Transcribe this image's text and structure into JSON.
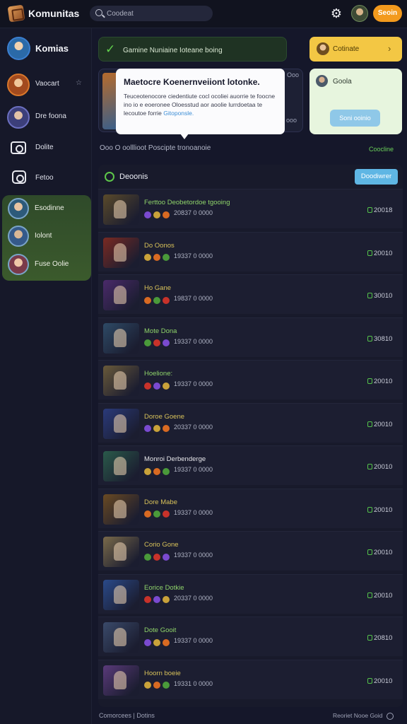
{
  "header": {
    "brand": "Komunitas",
    "search_placeholder": "Coodeat",
    "signin_label": "Seoin"
  },
  "sidebar": {
    "profile": {
      "label": "Komias"
    },
    "items": [
      {
        "label": "Vaocart",
        "icon": "avatar"
      },
      {
        "label": "Dre foona",
        "icon": "avatar"
      },
      {
        "label": "Dolite",
        "icon": "camera-icon"
      },
      {
        "label": "Fetoo",
        "icon": "camera-icon"
      }
    ],
    "group": [
      {
        "label": "Esodinne"
      },
      {
        "label": "Iolont"
      },
      {
        "label": "Fuse Oolie"
      }
    ]
  },
  "banner": {
    "text": "Gamine Nuniaine Ioteane boing"
  },
  "card_yellow": {
    "label": "Cotinate"
  },
  "card_green": {
    "label": "Goola",
    "button": "Soni ooinio"
  },
  "feature": {
    "side_label_top": "Ooo",
    "side_label_bottom": "ooo"
  },
  "popup": {
    "title": "Maetocre Koenernveiiont lotonke.",
    "body": "Teuceotenocore ciedentiute cocl ocoliei auorrie te foocne ino io e eoeronee Oloesstud aor aoolie lurrdoetaa te lecoutoe forrie",
    "link": "Gitoponsle."
  },
  "status": {
    "text": "Ooo O oolllioot Poscipte tronoanoie",
    "link": "Coocline"
  },
  "panel": {
    "title": "Deoonis",
    "button": "Doodiwrer",
    "rows": [
      {
        "name": "Ferttoo Deobetordoe tgooing",
        "name_color": "green",
        "meta": "20837 0 0000",
        "score": "20018",
        "thumb": "#5a4a2a"
      },
      {
        "name": "Do Oonos",
        "name_color": "yellow",
        "meta": "19337 0 0000",
        "score": "20010",
        "thumb": "#7a2a22"
      },
      {
        "name": "Ho Gane",
        "name_color": "yellow",
        "meta": "19837 0 0000",
        "score": "30010",
        "thumb": "#4a2a6a"
      },
      {
        "name": "Mote Dona",
        "name_color": "green",
        "meta": "19337 0 0000",
        "score": "30810",
        "thumb": "#2e4a66"
      },
      {
        "name": "Hoelione:",
        "name_color": "green",
        "meta": "19337 0 0000",
        "score": "20010",
        "thumb": "#6a5a3a"
      },
      {
        "name": "Doroe Goene",
        "name_color": "yellow",
        "meta": "20337 0 0000",
        "score": "20010",
        "thumb": "#2a3a7a"
      },
      {
        "name": "Monroi Derbenderge",
        "name_color": "white",
        "meta": "19337 0 0000",
        "score": "20010",
        "thumb": "#2a5a4a"
      },
      {
        "name": "Dore Mabe",
        "name_color": "yellow",
        "meta": "19337 0 0000",
        "score": "20010",
        "thumb": "#6a4a22"
      },
      {
        "name": "Corio Gone",
        "name_color": "yellow",
        "meta": "19337 0 0000",
        "score": "20010",
        "thumb": "#7a6a4a"
      },
      {
        "name": "Eorice Dotkie",
        "name_color": "green",
        "meta": "20337 0 0000",
        "score": "20010",
        "thumb": "#2a4a8a"
      },
      {
        "name": "Dote Gooit",
        "name_color": "green",
        "meta": "19337 0 0000",
        "score": "20810",
        "thumb": "#3a4a6a"
      },
      {
        "name": "Hoorn boeie",
        "name_color": "yellow",
        "meta": "19331 0 0000",
        "score": "20010",
        "thumb": "#5a3a7a"
      }
    ]
  },
  "footer": {
    "left": "Comorcees | Dotins",
    "right": "Reoriet Nooe Goid"
  }
}
